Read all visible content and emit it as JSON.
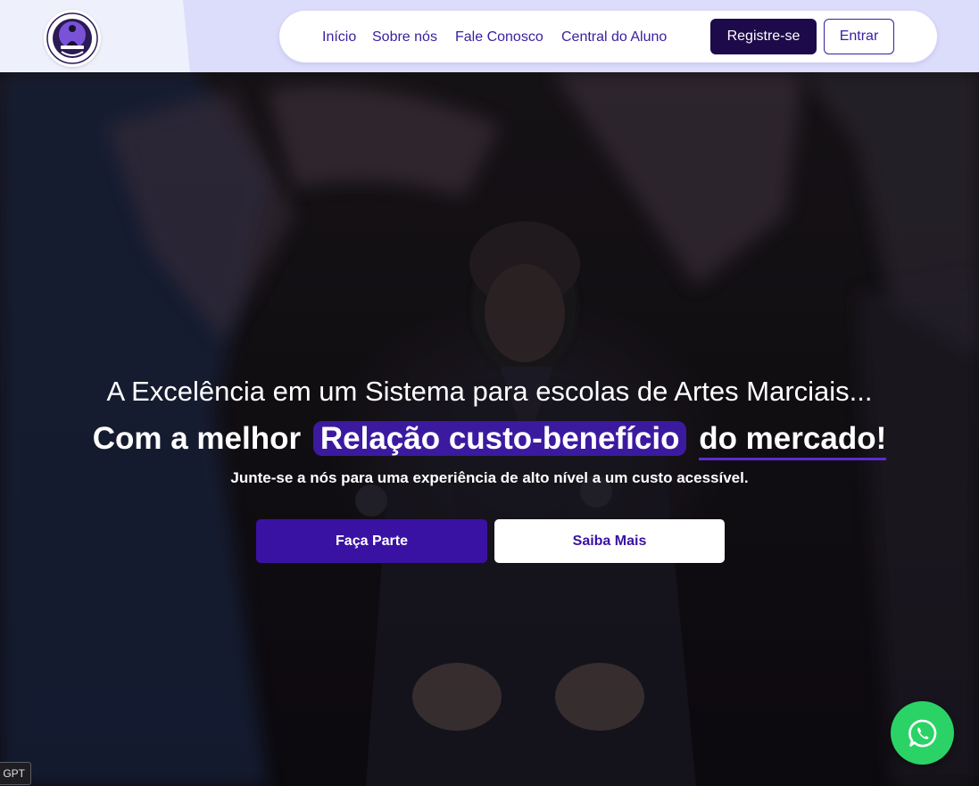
{
  "header": {
    "nav": [
      {
        "label": "Início"
      },
      {
        "label": "Sobre nós"
      },
      {
        "label": "Fale Conosco"
      },
      {
        "label": "Central do Aluno"
      }
    ],
    "register_label": "Registre-se",
    "login_label": "Entrar"
  },
  "hero": {
    "headline": "A Excelência em um Sistema para escolas de Artes Marciais...",
    "subheadline_prefix": "Com a melhor",
    "subheadline_highlight": "Relação custo-benefício",
    "subheadline_suffix": "do mercado!",
    "tagline": "Junte-se a nós para uma experiência de alto nível a um custo acessível.",
    "primary_button": "Faça Parte",
    "secondary_button": "Saiba Mais"
  },
  "floating": {
    "whatsapp_icon": "whatsapp-icon",
    "corner_tag": "GPT"
  },
  "colors": {
    "brand_dark": "#1c0a4a",
    "brand_purple": "#3a12a3",
    "header_bg": "#dcdcfb",
    "whatsapp_green": "#2bd366"
  }
}
